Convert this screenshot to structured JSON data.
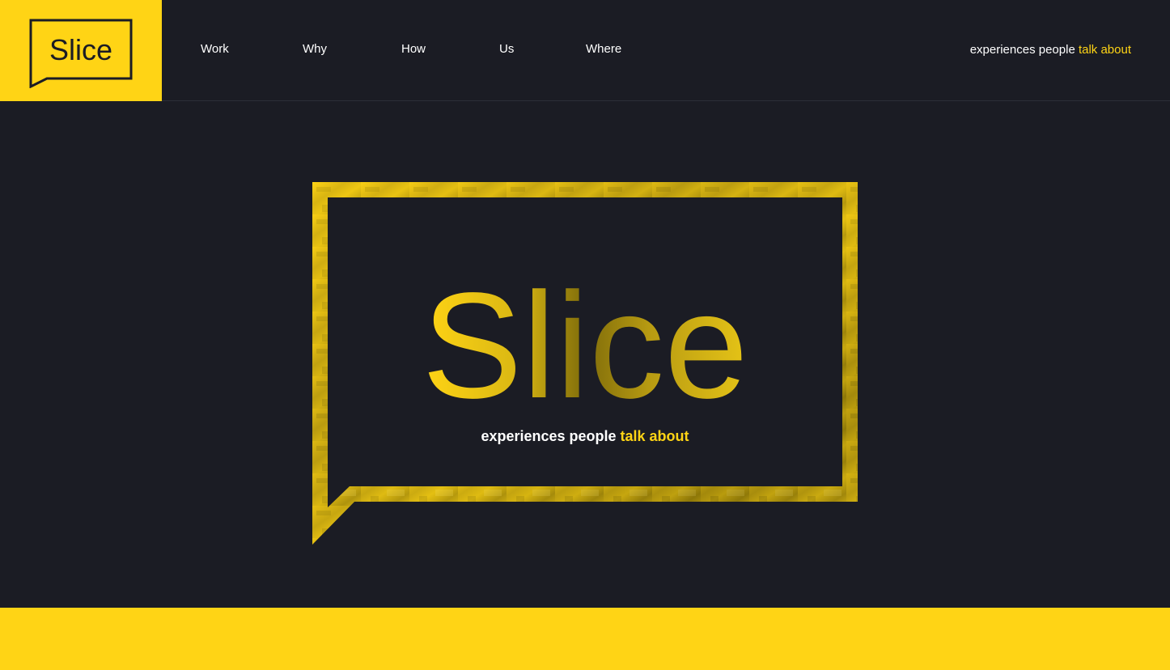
{
  "brand": {
    "name": "Slice",
    "accent_color": "#ffd415",
    "background_color": "#1b1c24"
  },
  "nav": {
    "items": [
      {
        "label": "Work"
      },
      {
        "label": "Why"
      },
      {
        "label": "How"
      },
      {
        "label": "Us"
      },
      {
        "label": "Where"
      }
    ]
  },
  "header": {
    "tagline_plain": "experiences people ",
    "tagline_accent": "talk about"
  },
  "hero": {
    "logo_text": "Slice",
    "tagline_plain": "experiences people ",
    "tagline_accent": "talk about"
  }
}
